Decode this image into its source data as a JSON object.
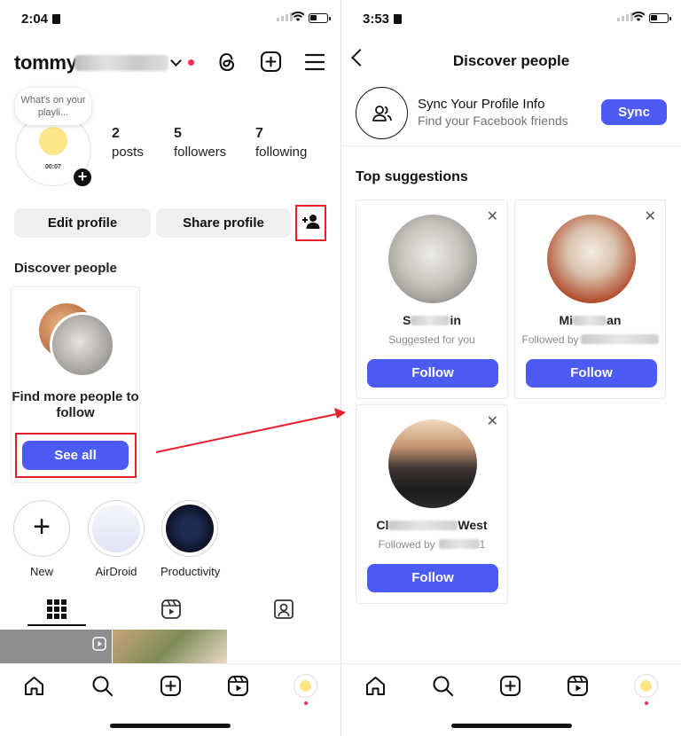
{
  "left": {
    "status": {
      "time": "2:04"
    },
    "header": {
      "username": "tommy"
    },
    "profile": {
      "note": "What's on your playli...",
      "avatar_time": "00:07",
      "stats": [
        {
          "num": "2",
          "label": "posts"
        },
        {
          "num": "5",
          "label": "followers"
        },
        {
          "num": "7",
          "label": "following"
        }
      ],
      "edit_label": "Edit profile",
      "share_label": "Share profile"
    },
    "discover": {
      "title": "Discover people",
      "card_text": "Find more people to follow",
      "see_all": "See all"
    },
    "highlights": [
      {
        "label": "New"
      },
      {
        "label": "AirDroid"
      },
      {
        "label": "Productivity"
      }
    ]
  },
  "right": {
    "status": {
      "time": "3:53"
    },
    "title": "Discover people",
    "sync": {
      "title": "Sync Your Profile Info",
      "subtitle": "Find your Facebook friends",
      "button": "Sync"
    },
    "top_suggestions": "Top suggestions",
    "cards": [
      {
        "name_start": "S",
        "name_end": "in",
        "sub": "Suggested for you",
        "sub_tail": "",
        "follow": "Follow"
      },
      {
        "name_start": "Mi",
        "name_end": "an",
        "sub": "Followed by",
        "sub_tail": "",
        "follow": "Follow"
      },
      {
        "name_start": "Cl",
        "name_end": "West",
        "sub": "Followed by",
        "sub_tail": "1",
        "follow": "Follow"
      }
    ]
  },
  "colors": {
    "accent": "#4c5bf4",
    "highlight_box": "#e8202a",
    "notification_dot": "#ff2d55"
  }
}
